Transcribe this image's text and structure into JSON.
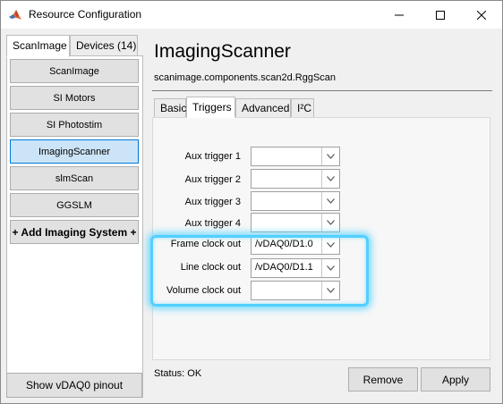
{
  "window": {
    "title": "Resource Configuration"
  },
  "left_tabs": [
    {
      "label": "ScanImage",
      "active": true
    },
    {
      "label": "Devices (14)",
      "active": false
    }
  ],
  "sidebar": {
    "items": [
      {
        "label": "ScanImage",
        "selected": false
      },
      {
        "label": "SI Motors",
        "selected": false
      },
      {
        "label": "SI Photostim",
        "selected": false
      },
      {
        "label": "ImagingScanner",
        "selected": true
      },
      {
        "label": "slmScan",
        "selected": false
      },
      {
        "label": "GGSLM",
        "selected": false
      },
      {
        "label": "+ Add Imaging System +",
        "selected": false
      }
    ],
    "pinout_button": "Show vDAQ0 pinout"
  },
  "main": {
    "title": "ImagingScanner",
    "class_path": "scanimage.components.scan2d.RggScan",
    "tabs": [
      {
        "label": "Basic",
        "active": false
      },
      {
        "label": "Triggers",
        "active": true
      },
      {
        "label": "Advanced",
        "active": false
      },
      {
        "label": "I²C",
        "active": false
      }
    ],
    "triggers": [
      {
        "label": "Aux trigger 1",
        "value": ""
      },
      {
        "label": "Aux trigger 2",
        "value": ""
      },
      {
        "label": "Aux trigger 3",
        "value": ""
      },
      {
        "label": "Aux trigger 4",
        "value": ""
      },
      {
        "label": "Frame clock out",
        "value": "/vDAQ0/D1.0"
      },
      {
        "label": "Line clock out",
        "value": "/vDAQ0/D1.1"
      },
      {
        "label": "Volume clock out",
        "value": ""
      }
    ]
  },
  "footer": {
    "status": "Status: OK",
    "remove_label": "Remove",
    "apply_label": "Apply"
  },
  "colors": {
    "highlight": "#52d0ff",
    "selected_item": "#cce4f7",
    "selected_border": "#0078d7"
  }
}
